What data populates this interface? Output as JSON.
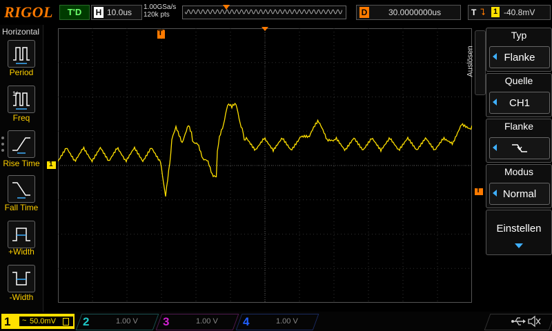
{
  "top_bar": {
    "logo": "RIGOL",
    "run_status": "T'D",
    "timebase_tag": "H",
    "timebase_value": "10.0us",
    "sample_rate": "1.00GSa/s",
    "memory_depth": "120k pts",
    "delay_tag": "D",
    "delay_value": "30.0000000us",
    "trigger_tag": "T",
    "trigger_source": "1",
    "trigger_level": "-40.8mV"
  },
  "left_menu": {
    "title": "Horizontal",
    "items": [
      {
        "label": "Period",
        "icon": "period-icon"
      },
      {
        "label": "Freq",
        "icon": "frequency-icon"
      },
      {
        "label": "Rise Time",
        "icon": "rise-time-icon"
      },
      {
        "label": "Fall Time",
        "icon": "fall-time-icon"
      },
      {
        "label": "+Width",
        "icon": "positive-width-icon"
      },
      {
        "label": "-Width",
        "icon": "negative-width-icon"
      }
    ]
  },
  "right_menu": {
    "side_tab": "Auslösen",
    "groups": [
      {
        "title": "Typ",
        "value": "Flanke"
      },
      {
        "title": "Quelle",
        "value": "CH1"
      },
      {
        "title": "Flanke",
        "value": "falling-edge-icon"
      },
      {
        "title": "Modus",
        "value": "Normal"
      }
    ],
    "settings_label": "Einstellen"
  },
  "screen": {
    "ch1_marker": "1",
    "trigger_position_marker": "T"
  },
  "bottom_bar": {
    "channels": [
      {
        "num": "1",
        "value": "50.0mV",
        "coupling": "~",
        "color": "#ffe000",
        "active": true
      },
      {
        "num": "2",
        "value": "1.00 V",
        "color": "#1ec6c6",
        "active": false
      },
      {
        "num": "3",
        "value": "1.00 V",
        "color": "#d020d0",
        "active": false
      },
      {
        "num": "4",
        "value": "1.00 V",
        "color": "#2060ff",
        "active": false
      }
    ]
  },
  "colors": {
    "ch1": "#ffe000",
    "accent": "#ff7a00",
    "menu_arrow": "#3fb0ff"
  }
}
